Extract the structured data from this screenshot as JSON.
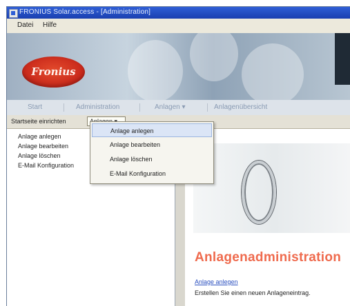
{
  "window": {
    "title": "FRONIUS Solar.access - [Administration]"
  },
  "menubar": {
    "items": [
      "Datei",
      "Hilfe"
    ]
  },
  "logo": {
    "text": "Fronius"
  },
  "nav": {
    "items": [
      "Start",
      "Administration",
      "Anlagen ▾",
      "Anlagenübersicht"
    ]
  },
  "subbar": {
    "label": "Startseite einrichten",
    "dropdown": "Anlagen ▾"
  },
  "left_list": {
    "items": [
      "Anlage anlegen",
      "Anlage bearbeiten",
      "Anlage löschen",
      "E-Mail Konfiguration"
    ]
  },
  "dropdown_menu": {
    "items": [
      "Anlage anlegen",
      "Anlage bearbeiten",
      "Anlage löschen",
      "E-Mail Konfiguration"
    ]
  },
  "content": {
    "heading": "Anlagenadministration",
    "link": "Anlage anlegen",
    "description": "Erstellen Sie einen neuen Anlageneintrag."
  },
  "colors": {
    "accent": "#ef6a4d",
    "title_bar": "#2f5fd6",
    "link": "#2a4fbf"
  }
}
